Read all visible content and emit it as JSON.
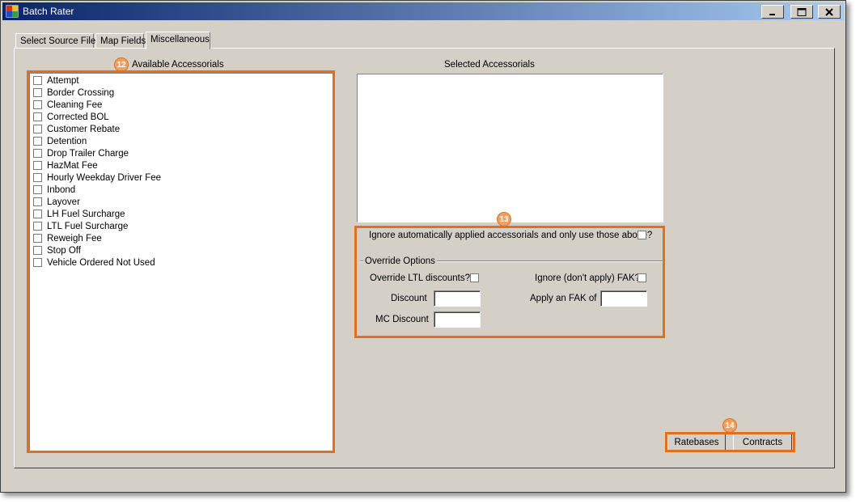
{
  "window": {
    "title": "Batch Rater"
  },
  "tabs": [
    {
      "label": "Select Source File"
    },
    {
      "label": "Map Fields"
    },
    {
      "label": "Miscellaneous"
    }
  ],
  "available": {
    "label": "Available Accessorials",
    "badge": "12",
    "items": [
      "Attempt",
      "Border Crossing",
      "Cleaning Fee",
      "Corrected BOL",
      "Customer Rebate",
      "Detention",
      "Drop Trailer Charge",
      "HazMat Fee",
      "Hourly Weekday Driver Fee",
      "Inbond",
      "Layover",
      "LH Fuel Surcharge",
      "LTL Fuel Surcharge",
      "Reweigh Fee",
      "Stop Off",
      "Vehicle Ordered Not Used"
    ]
  },
  "selected": {
    "label": "Selected Accessorials"
  },
  "options": {
    "badge": "13",
    "ignore_auto_label": "Ignore automatically applied accessorials and only use those above?",
    "override_group_label": "Override Options",
    "override_ltl_label": "Override LTL discounts?",
    "ignore_fak_label": "Ignore (don't apply) FAK?",
    "discount_label": "Discount",
    "apply_fak_label": "Apply an FAK of",
    "mc_discount_label": "MC Discount"
  },
  "buttons": {
    "badge": "14",
    "ratebases": "Ratebases",
    "contracts": "Contracts"
  }
}
